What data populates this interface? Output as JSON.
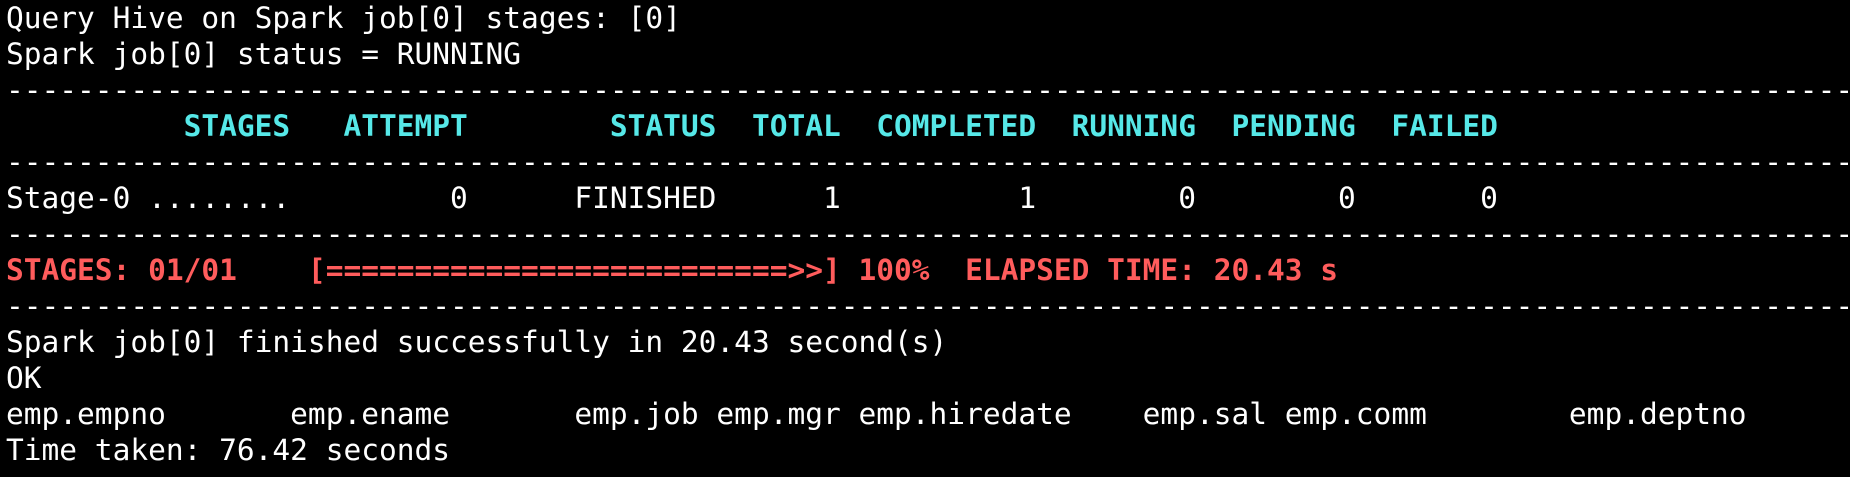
{
  "terminal": {
    "lines": [
      {
        "type": "text",
        "text": "Query Hive on Spark job[0] stages: [0]"
      },
      {
        "type": "text",
        "text": "Spark job[0] status = RUNNING"
      },
      {
        "type": "separator",
        "text": "--------------------------------------------------------------------------------------------------------------"
      },
      {
        "type": "header",
        "text": "          STAGES   ATTEMPT        STATUS  TOTAL  COMPLETED  RUNNING  PENDING  FAILED"
      },
      {
        "type": "separator",
        "text": "--------------------------------------------------------------------------------------------------------------"
      },
      {
        "type": "text",
        "text": "Stage-0 ........         0      FINISHED      1          1        0        0       0"
      },
      {
        "type": "separator",
        "text": "--------------------------------------------------------------------------------------------------------------"
      },
      {
        "type": "progress",
        "text": "STAGES: 01/01    [==========================>>] 100%  ELAPSED TIME: 20.43 s"
      },
      {
        "type": "separator",
        "text": "--------------------------------------------------------------------------------------------------------------"
      },
      {
        "type": "text",
        "text": "Spark job[0] finished successfully in 20.43 second(s)"
      },
      {
        "type": "text",
        "text": "OK"
      },
      {
        "type": "text",
        "text": "emp.empno       emp.ename       emp.job emp.mgr emp.hiredate    emp.sal emp.comm        emp.deptno"
      },
      {
        "type": "text",
        "text": "Time taken: 76.42 seconds"
      }
    ]
  },
  "colors": {
    "background": "#000000",
    "text": "#ffffff",
    "header": "#56e8e8",
    "progress": "#ff5c5c"
  }
}
